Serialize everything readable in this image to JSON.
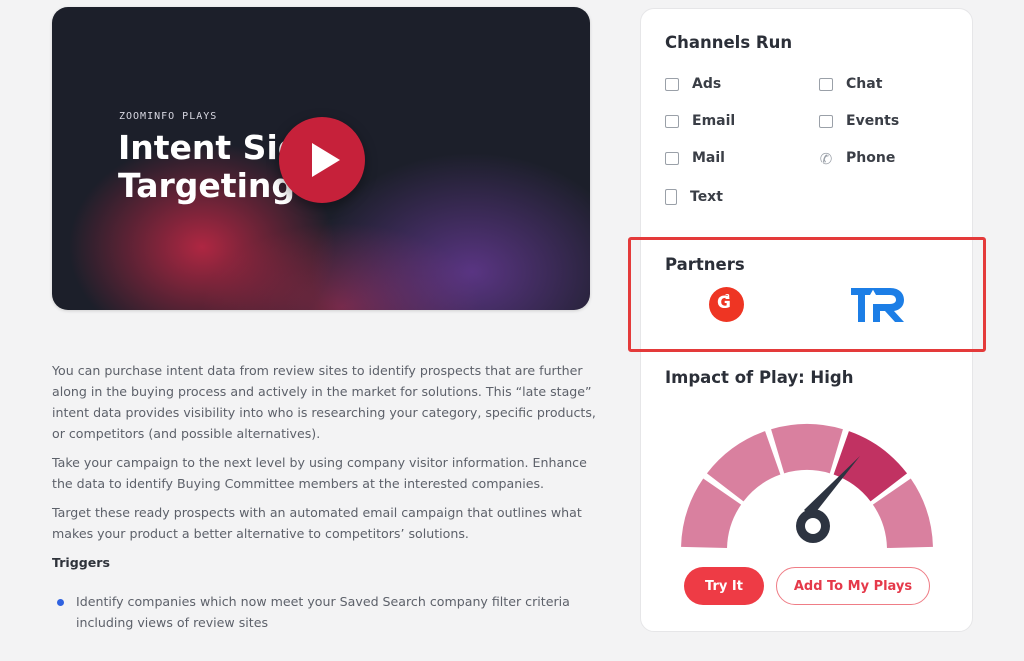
{
  "video": {
    "brand": "ZOOMINFO PLAYS",
    "title_line1": "Intent Signal",
    "title_line2": "Targeting"
  },
  "description": {
    "paragraphs": [
      "You can purchase intent data from review sites to identify prospects that are further along in the buying process and actively in the market for solutions. This “late stage” intent data provides visibility into who is researching your category, specific products, or competitors (and possible alternatives).",
      "Take your campaign to the next level by using company visitor information. Enhance the data to identify Buying Committee members at the interested companies.",
      "Target these ready prospects with an automated email campaign that outlines what makes your product a better alternative to competitors’ solutions."
    ],
    "triggers_heading": "Triggers",
    "triggers": [
      "Identify companies which now meet your Saved Search company filter criteria including views of review sites"
    ]
  },
  "channels": {
    "title": "Channels Run",
    "items": [
      {
        "label": "Ads",
        "icon": "ads-icon"
      },
      {
        "label": "Chat",
        "icon": "chat-icon"
      },
      {
        "label": "Email",
        "icon": "email-icon"
      },
      {
        "label": "Events",
        "icon": "events-icon"
      },
      {
        "label": "Mail",
        "icon": "mail-icon"
      },
      {
        "label": "Phone",
        "icon": "phone-icon"
      },
      {
        "label": "Text",
        "icon": "text-icon"
      }
    ]
  },
  "partners": {
    "title": "Partners",
    "logos": [
      "g2-logo",
      "trustradius-logo"
    ],
    "g2_mark": "G",
    "g2_sup": "2"
  },
  "impact": {
    "title": "Impact of Play: High",
    "level_segment": 4,
    "segments": 5,
    "colors": {
      "segment": "#d9809f",
      "segment_active": "#c13262",
      "needle": "#2d3441"
    }
  },
  "actions": {
    "try_label": "Try It",
    "add_label": "Add To My Plays"
  },
  "colors": {
    "accent": "#ee3b45",
    "highlight_border": "#e43a3a",
    "bullet": "#2f62e0"
  }
}
